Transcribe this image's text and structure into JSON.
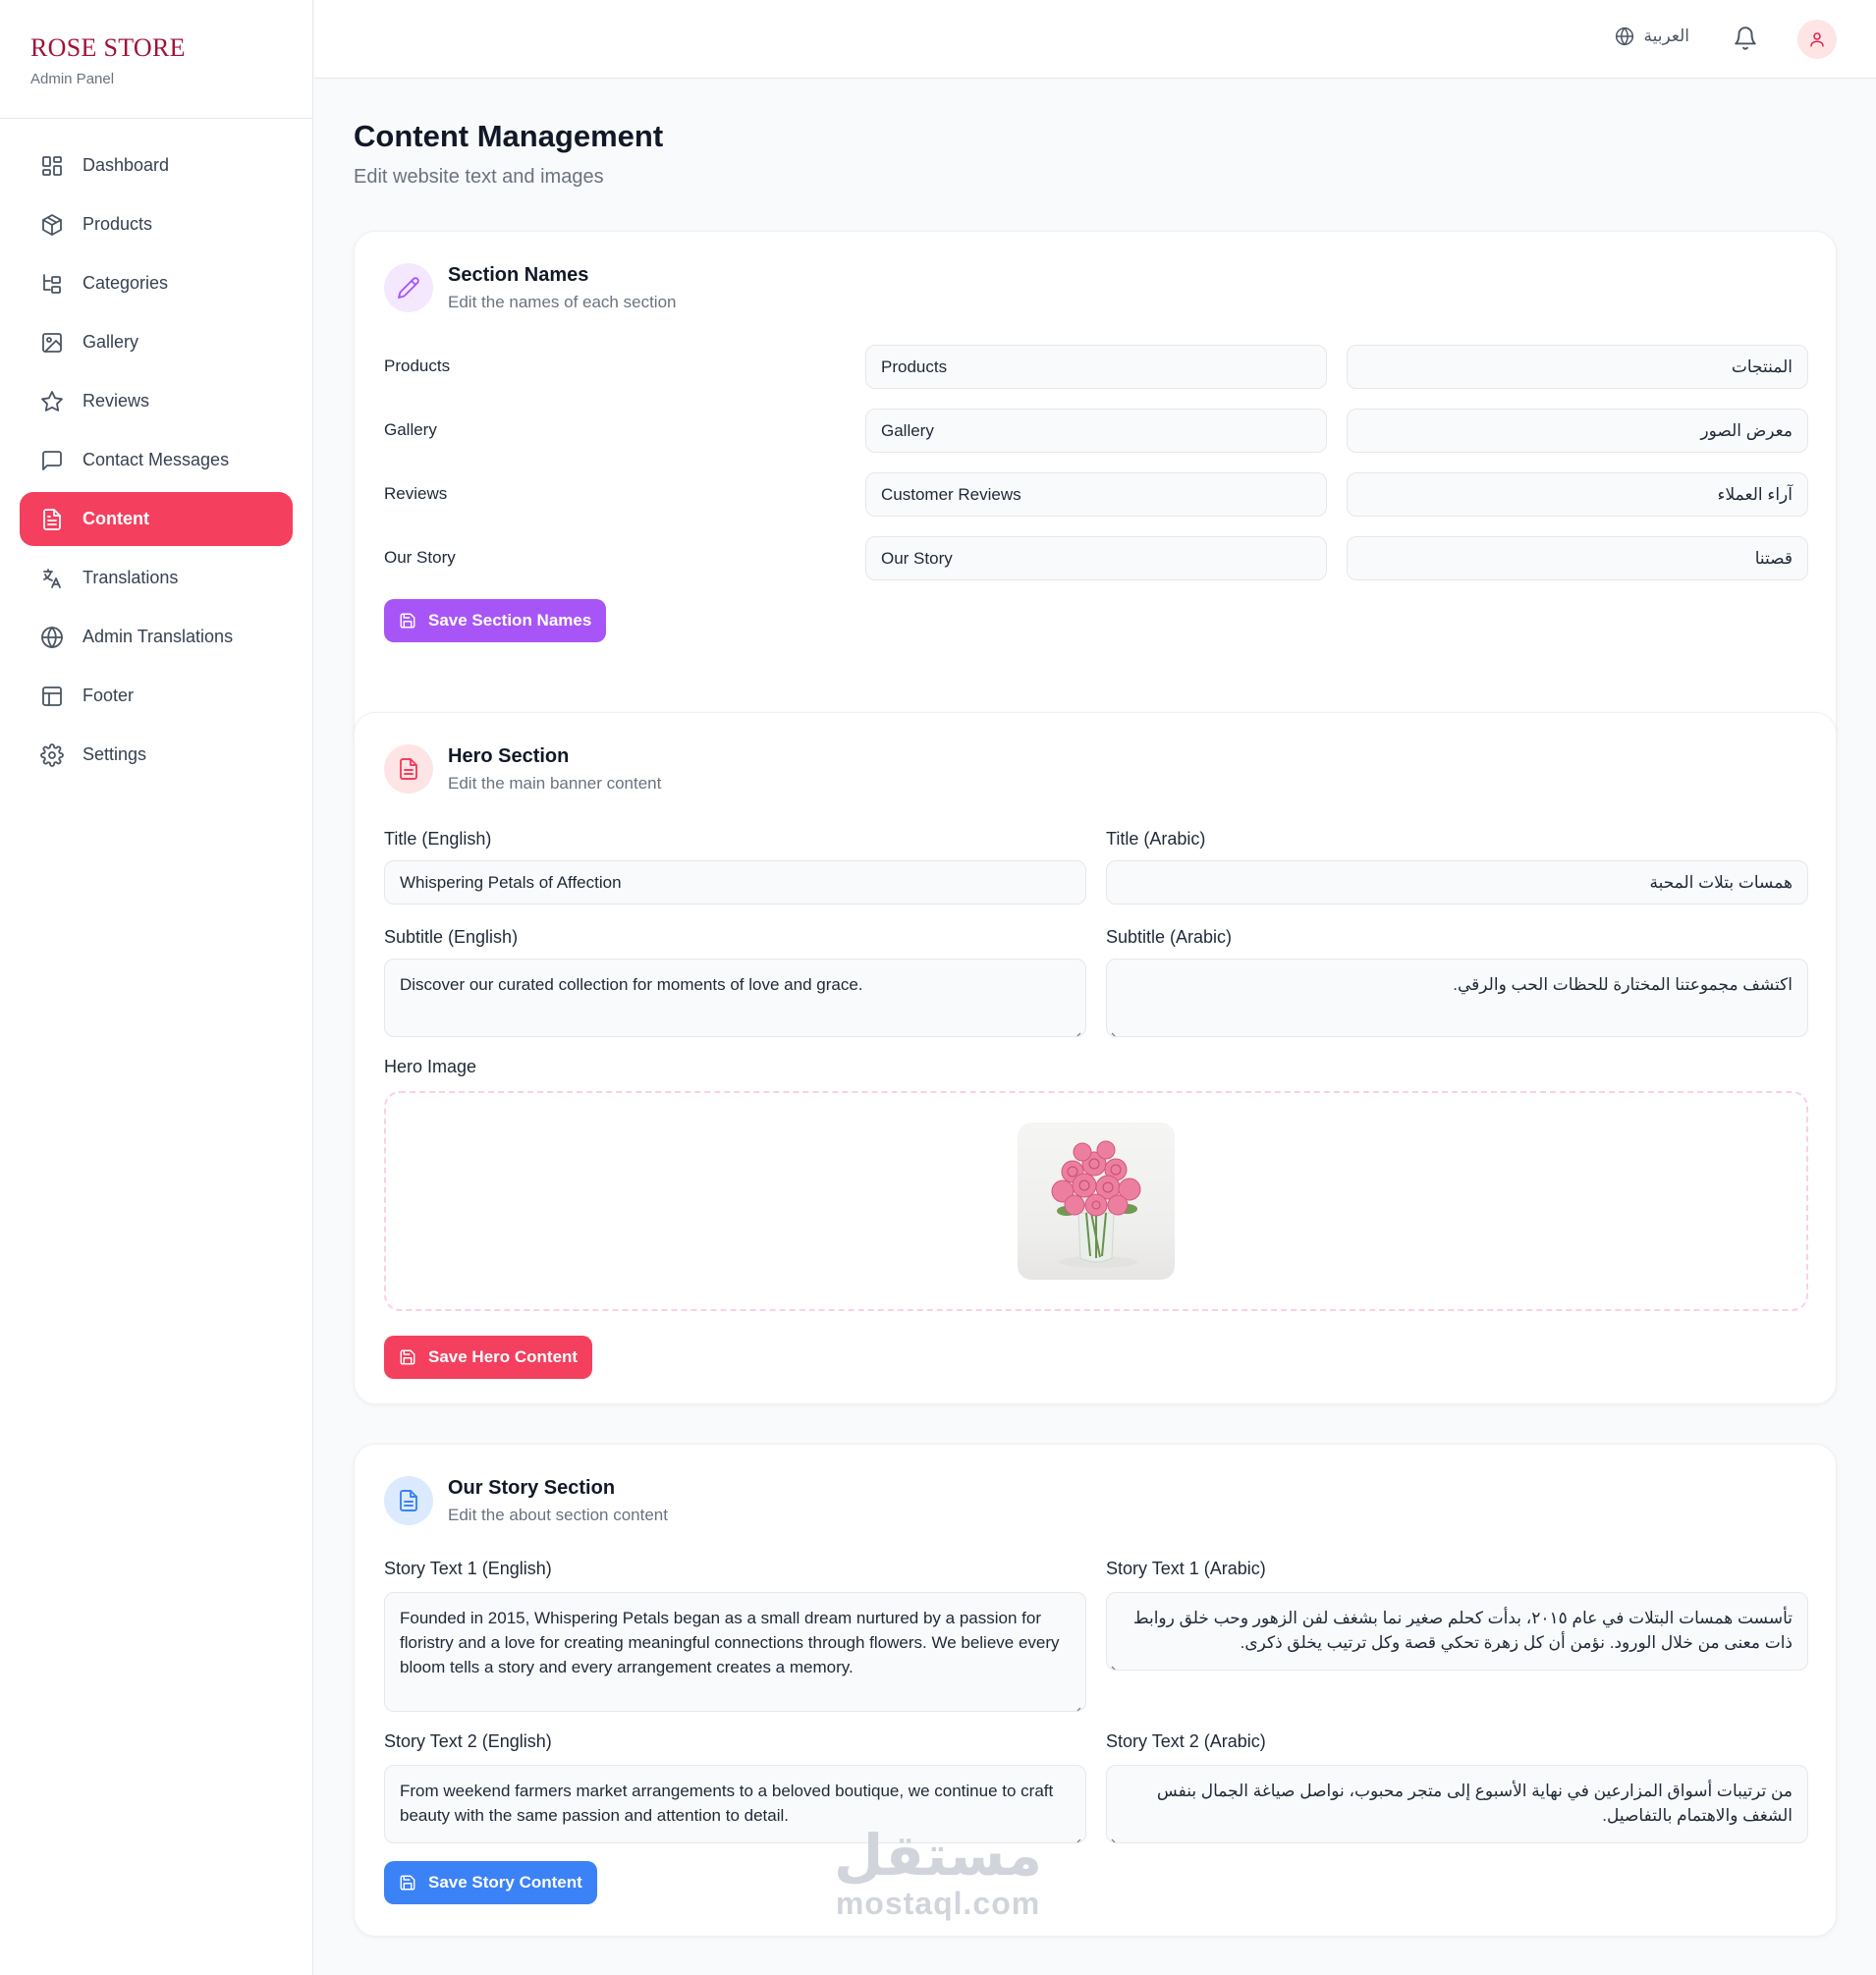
{
  "brand": {
    "name": "ROSE STORE",
    "subtitle": "Admin Panel"
  },
  "sidebar": {
    "items": [
      {
        "label": "Dashboard",
        "icon": "dashboard-icon",
        "active": false
      },
      {
        "label": "Products",
        "icon": "package-icon",
        "active": false
      },
      {
        "label": "Categories",
        "icon": "tree-icon",
        "active": false
      },
      {
        "label": "Gallery",
        "icon": "image-icon",
        "active": false
      },
      {
        "label": "Reviews",
        "icon": "star-icon",
        "active": false
      },
      {
        "label": "Contact Messages",
        "icon": "message-icon",
        "active": false
      },
      {
        "label": "Content",
        "icon": "document-icon",
        "active": true
      },
      {
        "label": "Translations",
        "icon": "translate-icon",
        "active": false
      },
      {
        "label": "Admin Translations",
        "icon": "globe-icon",
        "active": false
      },
      {
        "label": "Footer",
        "icon": "layout-icon",
        "active": false
      },
      {
        "label": "Settings",
        "icon": "gear-icon",
        "active": false
      }
    ]
  },
  "topbar": {
    "language_label": "العربية"
  },
  "page": {
    "title": "Content Management",
    "subtitle": "Edit website text and images"
  },
  "section_names": {
    "title": "Section Names",
    "subtitle": "Edit the names of each section",
    "rows": [
      {
        "label": "Products",
        "en": "Products",
        "ar": "المنتجات"
      },
      {
        "label": "Gallery",
        "en": "Gallery",
        "ar": "معرض الصور"
      },
      {
        "label": "Reviews",
        "en": "Customer Reviews",
        "ar": "آراء العملاء"
      },
      {
        "label": "Our Story",
        "en": "Our Story",
        "ar": "قصتنا"
      }
    ],
    "save_label": "Save Section Names"
  },
  "hero": {
    "title": "Hero Section",
    "subtitle": "Edit the main banner content",
    "title_en_label": "Title (English)",
    "title_en": "Whispering Petals of Affection",
    "title_ar_label": "Title (Arabic)",
    "title_ar": "همسات بتلات المحبة",
    "subtitle_en_label": "Subtitle (English)",
    "subtitle_en": "Discover our curated collection for moments of love and grace.",
    "subtitle_ar_label": "Subtitle (Arabic)",
    "subtitle_ar": "اكتشف مجموعتنا المختارة للحظات الحب والرقي.",
    "image_label": "Hero Image",
    "save_label": "Save Hero Content"
  },
  "story": {
    "title": "Our Story Section",
    "subtitle": "Edit the about section content",
    "text1_en_label": "Story Text 1 (English)",
    "text1_en": "Founded in 2015, Whispering Petals began as a small dream nurtured by a passion for floristry and a love for creating meaningful connections through flowers. We believe every bloom tells a story and every arrangement creates a memory.",
    "text1_ar_label": "Story Text 1 (Arabic)",
    "text1_ar": "تأسست همسات البتلات في عام ٢٠١٥، بدأت كحلم صغير نما بشغف لفن الزهور وحب خلق روابط ذات معنى من خلال الورود. نؤمن أن كل زهرة تحكي قصة وكل ترتيب يخلق ذكرى.",
    "text2_en_label": "Story Text 2 (English)",
    "text2_en": "From weekend farmers market arrangements to a beloved boutique, we continue to craft beauty with the same passion and attention to detail.",
    "text2_ar_label": "Story Text 2 (Arabic)",
    "text2_ar": "من ترتيبات أسواق المزارعين في نهاية الأسبوع إلى متجر محبوب، نواصل صياغة الجمال بنفس الشغف والاهتمام بالتفاصيل.",
    "save_label": "Save Story Content"
  },
  "watermark": {
    "arabic": "مستقل",
    "latin": "mostaql.com"
  },
  "colors": {
    "accent": "#f43f5e",
    "brand": "#9f1239",
    "purple_button": "#a855f7",
    "blue_button": "#3b82f6"
  }
}
